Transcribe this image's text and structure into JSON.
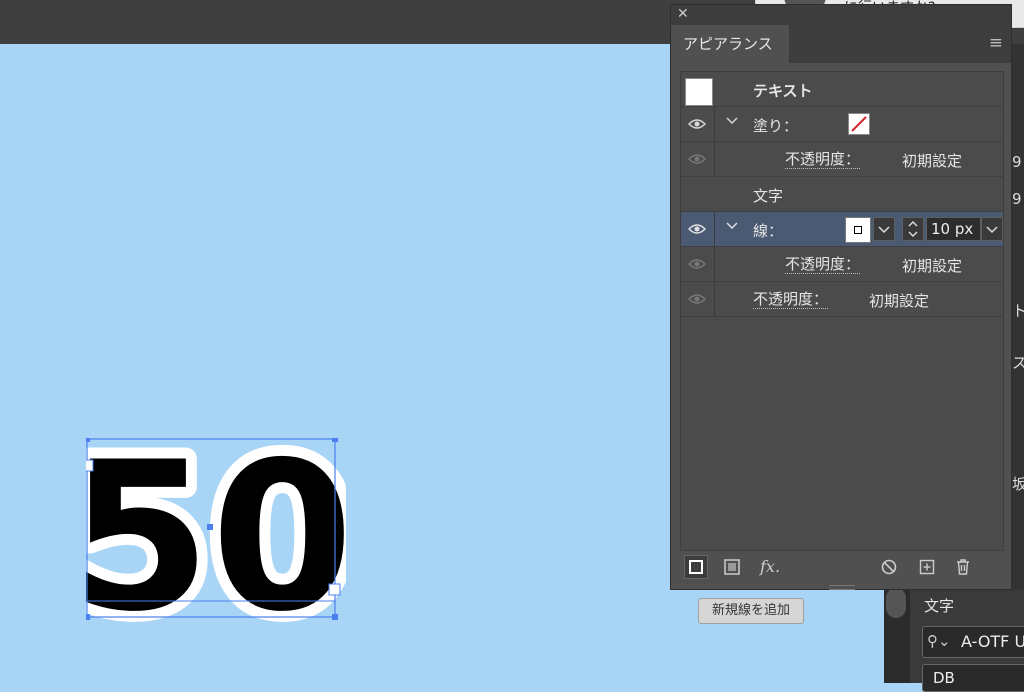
{
  "notification": {
    "text": "に行いますか?"
  },
  "panel": {
    "close_glyph": "✕",
    "tab_label": "アピアランス",
    "menu_glyph": "≡",
    "rows": {
      "object": "テキスト",
      "fill_label": "塗り：",
      "fill_opacity_label": "不透明度：",
      "fill_opacity_value": "初期設定",
      "char_label": "文字",
      "stroke_label": "線：",
      "stroke_width": "10 px",
      "stroke_opacity_label": "不透明度：",
      "stroke_opacity_value": "初期設定",
      "opacity_label": "不透明度：",
      "opacity_value": "初期設定"
    },
    "bottom": {
      "fx_label": "fx."
    }
  },
  "tooltip": "新規線を追加",
  "dock": {
    "frag1": "9",
    "frag2": "9",
    "frag3": "ト",
    "frag4": "ス",
    "frag5": "坂",
    "char_title": "文字",
    "font_name": "A-OTF U",
    "font_style": "DB"
  },
  "artwork": {
    "text": "50",
    "stroke_color": "#ffffff",
    "fill_color": "#000000"
  },
  "colors": {
    "canvas": "#a8d4f6",
    "panel": "#505050",
    "selection": "#4a5a73",
    "bbox": "#4a7ff0"
  }
}
